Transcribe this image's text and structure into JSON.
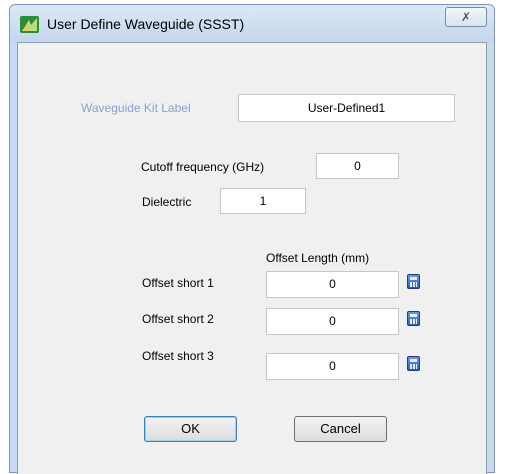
{
  "window": {
    "title": "User Define Waveguide (SSST)",
    "close_glyph": "✗"
  },
  "kit_label": {
    "label": "Waveguide Kit Label",
    "value": "User-Defined1"
  },
  "cutoff": {
    "label": "Cutoff frequency (GHz)",
    "value": "0"
  },
  "dielectric": {
    "label": "Dielectric",
    "value": "1"
  },
  "offset_header": "Offset Length (mm)",
  "offsets": [
    {
      "label": "Offset short 1",
      "value": "0"
    },
    {
      "label": "Offset short 2",
      "value": "0"
    },
    {
      "label": "Offset short 3",
      "value": "0"
    }
  ],
  "buttons": {
    "ok": "OK",
    "cancel": "Cancel"
  },
  "icons": {
    "app": "app-icon",
    "calc": "calculator-icon"
  }
}
